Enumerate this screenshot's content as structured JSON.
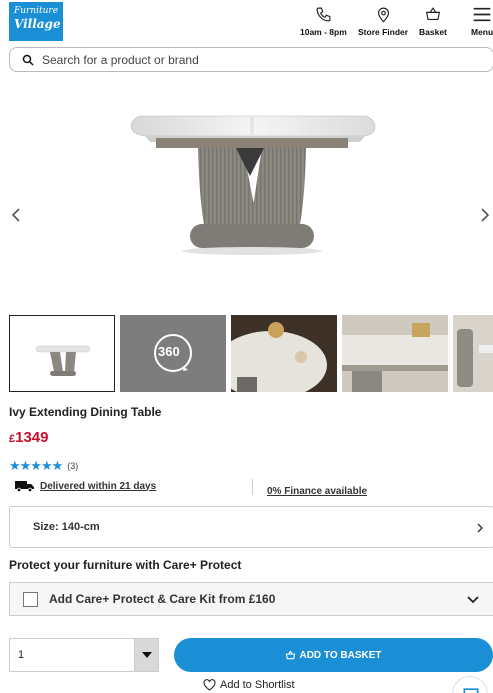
{
  "header": {
    "logo_line1": "Furniture",
    "logo_line2": "Village",
    "nav": [
      {
        "label": "10am - 8pm",
        "icon": "phone-icon"
      },
      {
        "label": "Store Finder",
        "icon": "location-pin-icon"
      },
      {
        "label": "Basket",
        "icon": "basket-icon"
      },
      {
        "label": "Menu",
        "icon": "hamburger-icon"
      }
    ]
  },
  "search": {
    "placeholder": "Search for a product or brand",
    "icon": "search-icon"
  },
  "gallery": {
    "prev_icon": "chevron-left-icon",
    "next_icon": "chevron-right-icon",
    "thumb_360_label": "360"
  },
  "product": {
    "title": "Ivy Extending Dining Table",
    "currency": "£",
    "price": "1349",
    "rating_stars": "★★★★★",
    "rating": 5,
    "review_count": "(3)",
    "delivery_label": "Delivered within 21 days",
    "finance_label": "0% Finance available"
  },
  "size_selector": {
    "label": "Size: 140-cm"
  },
  "care": {
    "heading": "Protect your furniture with Care+ Protect",
    "option_label": "Add Care+ Protect & Care Kit from £160",
    "checked": false
  },
  "purchase": {
    "quantity": "1",
    "add_label": "ADD TO BASKET",
    "shortlist_label": "Add to Shortlist"
  },
  "colors": {
    "brand_blue": "#1a8fd6",
    "price_red": "#c8102e"
  }
}
